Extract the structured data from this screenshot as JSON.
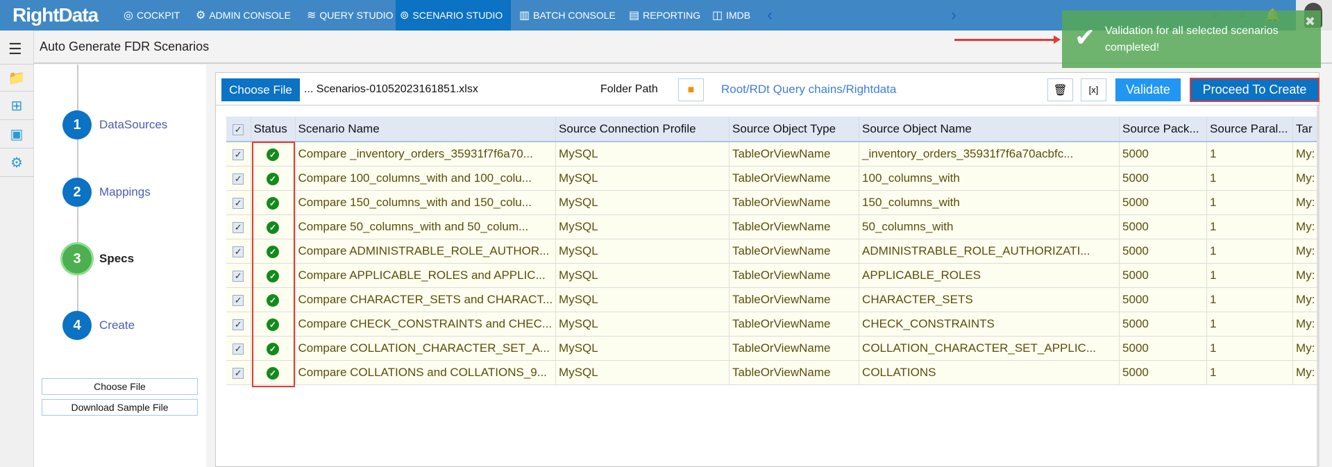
{
  "app": {
    "logo": "RightData",
    "page_title": "Auto Generate FDR Scenarios"
  },
  "nav": [
    {
      "label": "COCKPIT",
      "icon": "cockpit-icon"
    },
    {
      "label": "ADMIN CONSOLE",
      "icon": "gear-icon"
    },
    {
      "label": "QUERY STUDIO",
      "icon": "database-icon"
    },
    {
      "label": "SCENARIO STUDIO",
      "icon": "scenario-icon",
      "active": true
    },
    {
      "label": "BATCH CONSOLE",
      "icon": "batch-icon"
    },
    {
      "label": "REPORTING",
      "icon": "report-icon"
    },
    {
      "label": "IMDB",
      "icon": "imdb-icon"
    }
  ],
  "toast": {
    "message": "Validation for all selected scenarios completed!"
  },
  "steps": [
    {
      "num": "1",
      "label": "DataSources"
    },
    {
      "num": "2",
      "label": "Mappings"
    },
    {
      "num": "3",
      "label": "Specs",
      "current": true
    },
    {
      "num": "4",
      "label": "Create"
    }
  ],
  "side_buttons": {
    "choose_file": "Choose File",
    "download_sample": "Download Sample File"
  },
  "toolbar": {
    "choose_file": "Choose File",
    "file_name": "... Scenarios-01052023161851.xlsx",
    "folder_label": "Folder Path",
    "folder_path": "Root/RDt Query chains/Rightdata",
    "validate": "Validate",
    "proceed": "Proceed To Create"
  },
  "table": {
    "headers": [
      "Status",
      "Scenario Name",
      "Source Connection Profile",
      "Source Object Type",
      "Source Object Name",
      "Source Pack...",
      "Source Paral...",
      "Tar"
    ],
    "rows": [
      [
        "Compare _inventory_orders_35931f7f6a70...",
        "MySQL",
        "TableOrViewName",
        "_inventory_orders_35931f7f6a70acbfc...",
        "5000",
        "1",
        "My:"
      ],
      [
        "Compare 100_columns_with and 100_colu...",
        "MySQL",
        "TableOrViewName",
        "100_columns_with",
        "5000",
        "1",
        "My:"
      ],
      [
        "Compare 150_columns_with and 150_colu...",
        "MySQL",
        "TableOrViewName",
        "150_columns_with",
        "5000",
        "1",
        "My:"
      ],
      [
        "Compare 50_columns_with and 50_colum...",
        "MySQL",
        "TableOrViewName",
        "50_columns_with",
        "5000",
        "1",
        "My:"
      ],
      [
        "Compare ADMINISTRABLE_ROLE_AUTHOR...",
        "MySQL",
        "TableOrViewName",
        "ADMINISTRABLE_ROLE_AUTHORIZATI...",
        "5000",
        "1",
        "My:"
      ],
      [
        "Compare APPLICABLE_ROLES and APPLIC...",
        "MySQL",
        "TableOrViewName",
        "APPLICABLE_ROLES",
        "5000",
        "1",
        "My:"
      ],
      [
        "Compare CHARACTER_SETS and CHARACT...",
        "MySQL",
        "TableOrViewName",
        "CHARACTER_SETS",
        "5000",
        "1",
        "My:"
      ],
      [
        "Compare CHECK_CONSTRAINTS and CHEC...",
        "MySQL",
        "TableOrViewName",
        "CHECK_CONSTRAINTS",
        "5000",
        "1",
        "My:"
      ],
      [
        "Compare COLLATION_CHARACTER_SET_A...",
        "MySQL",
        "TableOrViewName",
        "COLLATION_CHARACTER_SET_APPLIC...",
        "5000",
        "1",
        "My:"
      ],
      [
        "Compare COLLATIONS and COLLATIONS_9...",
        "MySQL",
        "TableOrViewName",
        "COLLATIONS",
        "5000",
        "1",
        "My:"
      ]
    ]
  }
}
